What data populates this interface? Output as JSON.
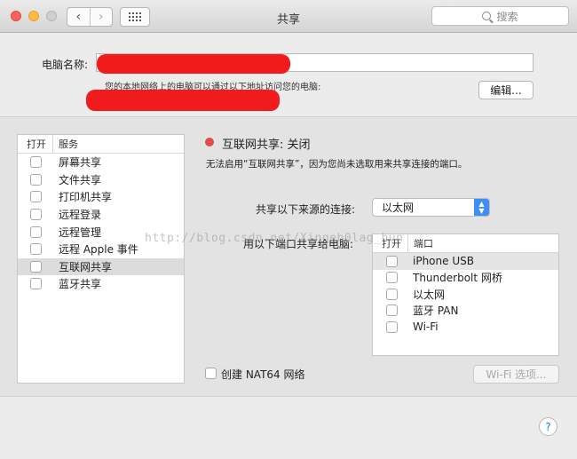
{
  "window": {
    "title": "共享",
    "search_placeholder": "搜索",
    "back_icon": "‹",
    "forward_icon": "›"
  },
  "computer_name": {
    "label": "电脑名称:",
    "hint": "您的本地网络上的电脑可以通过以下地址访问您的电脑:",
    "edit_button": "编辑..."
  },
  "services": {
    "col_on": "打开",
    "col_service": "服务",
    "items": [
      {
        "label": "屏幕共享"
      },
      {
        "label": "文件共享"
      },
      {
        "label": "打印机共享"
      },
      {
        "label": "远程登录"
      },
      {
        "label": "远程管理"
      },
      {
        "label": "远程 Apple 事件"
      },
      {
        "label": "互联网共享"
      },
      {
        "label": "蓝牙共享"
      }
    ]
  },
  "detail": {
    "status_title": "互联网共享: 关闭",
    "status_color": "#e24b47",
    "status_desc": "无法启用“互联网共享”，因为您尚未选取用来共享连接的端口。",
    "source_label": "共享以下来源的连接:",
    "source_value": "以太网",
    "ports_label": "用以下端口共享给电脑:",
    "ports_col_on": "打开",
    "ports_col_port": "端口",
    "ports": [
      {
        "label": "iPhone USB"
      },
      {
        "label": "Thunderbolt 网桥"
      },
      {
        "label": "以太网"
      },
      {
        "label": "蓝牙 PAN"
      },
      {
        "label": "Wi-Fi"
      }
    ],
    "nat64_label": "创建 NAT64 网络",
    "wifi_options_button": "Wi-Fi 选项..."
  },
  "watermark": "http://blog.csdn.net/Xingeb0lag_hun",
  "help_label": "?"
}
